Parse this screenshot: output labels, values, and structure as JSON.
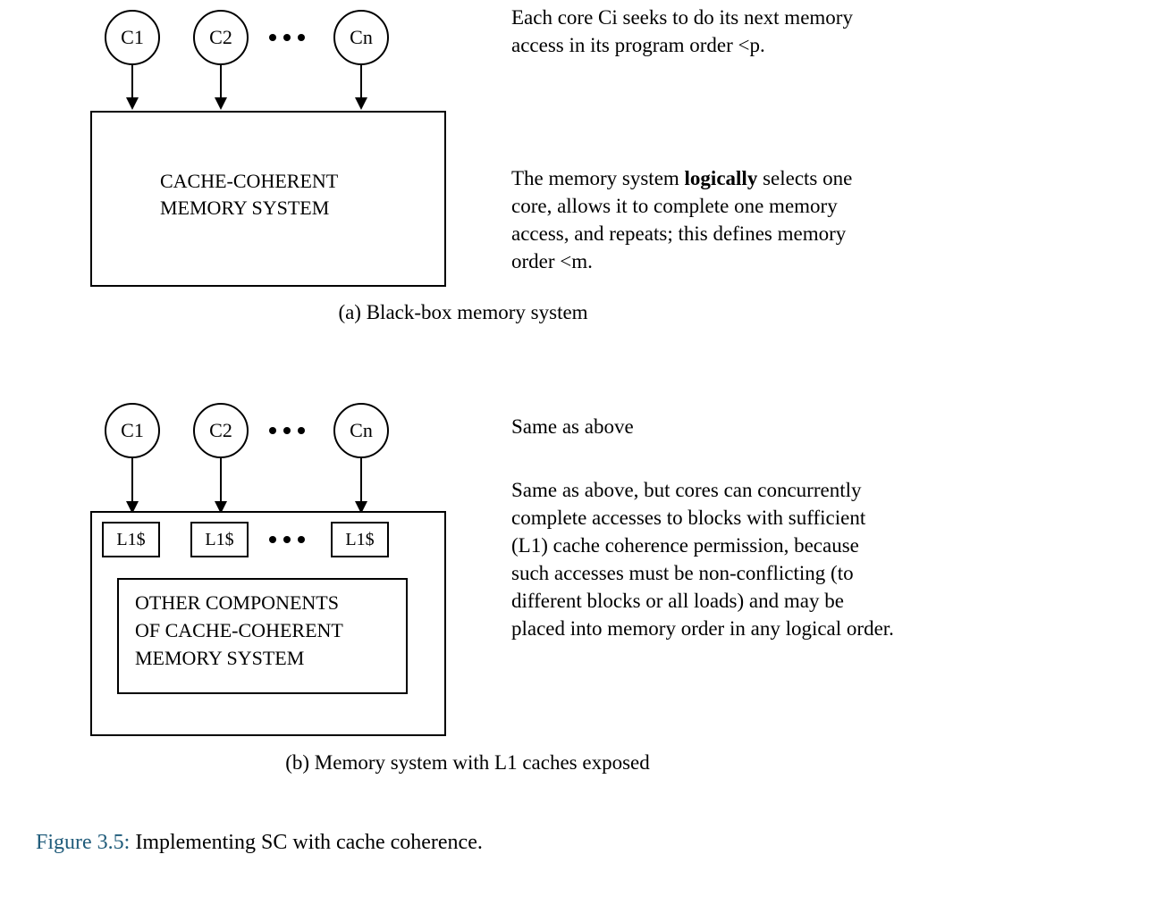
{
  "cores": {
    "c1": "C1",
    "c2": "C2",
    "cn": "Cn"
  },
  "mem_a": {
    "line1": "CACHE-COHERENT",
    "line2": "MEMORY SYSTEM"
  },
  "caption_a": "(a) Black-box memory system",
  "notes_a_top": "Each core Ci seeks to do its next memory access in its program order <p.",
  "notes_a_mid_pre": "The memory system ",
  "notes_a_mid_bold": "logically",
  "notes_a_mid_post": " selects one core, allows it to complete one memory access, and repeats; this defines memory order <m.",
  "l1": "L1$",
  "mem_b": {
    "line1": "OTHER COMPONENTS",
    "line2": "OF CACHE-COHERENT",
    "line3": "MEMORY SYSTEM"
  },
  "caption_b": "(b) Memory system with L1 caches exposed",
  "notes_b_top": "Same as above",
  "notes_b_main": "Same as above, but cores can concurrently complete accesses to blocks with sufficient (L1) cache coherence permission, because such accesses must be non-conflicting (to different blocks or all loads) and may be placed into memory order in any logical order.",
  "figure_label": "Figure 3.5:",
  "figure_text": " Implementing SC with cache coherence."
}
